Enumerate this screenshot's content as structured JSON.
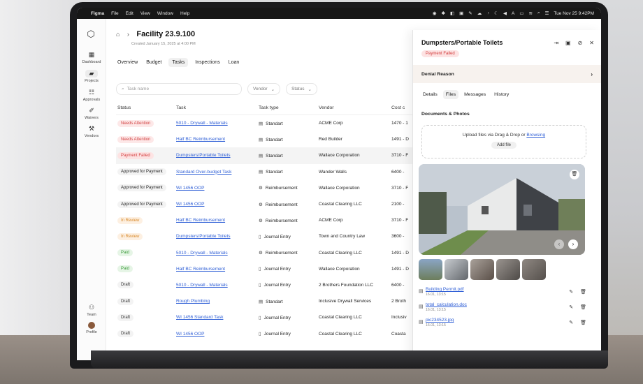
{
  "menubar": {
    "apple": "",
    "items": [
      "Figma",
      "File",
      "Edit",
      "View",
      "Window",
      "Help"
    ],
    "clock": "Tue Nov 25  9:42PM"
  },
  "rail": {
    "items": [
      {
        "label": "Dashboard",
        "icon": "grid-icon"
      },
      {
        "label": "Projects",
        "icon": "folder-icon"
      },
      {
        "label": "Approvals",
        "icon": "approvals-icon"
      },
      {
        "label": "Waivers",
        "icon": "waivers-icon"
      },
      {
        "label": "Vendors",
        "icon": "wrench-icon"
      },
      {
        "label": "Team",
        "icon": "team-icon"
      },
      {
        "label": "Profile",
        "icon": "avatar"
      }
    ]
  },
  "header": {
    "title": "Facility 23.9.100",
    "subtitle": "Created January 15, 2025 at 4:00 PM"
  },
  "tabs": [
    "Overview",
    "Budget",
    "Tasks",
    "Inspections",
    "Loan"
  ],
  "filters": {
    "search_placeholder": "Task name",
    "vendor": "Vendor",
    "status": "Status"
  },
  "table": {
    "columns": [
      "Status",
      "Task",
      "Task type",
      "Vendor",
      "Cost c"
    ],
    "rows": [
      {
        "status": "Needs Attention",
        "kind": "attn",
        "task": "5010 - Drywall - Materials",
        "type": "Standart",
        "vendor": "ACME Corp",
        "cost": "1470 - 1"
      },
      {
        "status": "Needs Attention",
        "kind": "attn",
        "task": "Half BC Reimbursement",
        "type": "Standart",
        "vendor": "Red Builder",
        "cost": "1491 - D"
      },
      {
        "status": "Payment Failed",
        "kind": "fail",
        "task": "Dumpsters/Portable Toilets",
        "type": "Standart",
        "vendor": "Wallace Corporation",
        "cost": "3710 - F"
      },
      {
        "status": "Approved for Payment",
        "kind": "appr",
        "task": "Standard Over-budget Task",
        "type": "Standart",
        "vendor": "Wander Walls",
        "cost": "6400 -"
      },
      {
        "status": "Approved for Payment",
        "kind": "appr",
        "task": "WI 1456 OOP",
        "type": "Reimbursement",
        "vendor": "Wallace Corporation",
        "cost": "3710 - F"
      },
      {
        "status": "Approved for Payment",
        "kind": "appr",
        "task": "WI 1456 OOP",
        "type": "Reimbursement",
        "vendor": "Coastal Clearing  LLC",
        "cost": "2100 -"
      },
      {
        "status": "In Review",
        "kind": "rev",
        "task": "Half BC Reimbursement",
        "type": "Reimbursement",
        "vendor": "ACME Corp",
        "cost": "3710 - F"
      },
      {
        "status": "In Review",
        "kind": "rev",
        "task": "Dumpsters/Portable Toilets",
        "type": "Journal Entry",
        "vendor": "Town and Country Law",
        "cost": "3600 -"
      },
      {
        "status": "Paid",
        "kind": "paid",
        "task": "5010 - Drywall - Materials",
        "type": "Reimbursement",
        "vendor": "Coastal Clearing  LLC",
        "cost": "1491 - D"
      },
      {
        "status": "Paid",
        "kind": "paid",
        "task": "Half BC Reimbursement",
        "type": "Journal Entry",
        "vendor": "Wallace Corporation",
        "cost": "1491 - D"
      },
      {
        "status": "Draft",
        "kind": "draft",
        "task": "5010 - Drywall - Materials",
        "type": "Journal Entry",
        "vendor": "2 Brothers Foundation LLC",
        "cost": "6400 -"
      },
      {
        "status": "Draft",
        "kind": "draft",
        "task": "Rough Plumbing",
        "type": "Standart",
        "vendor": "Inclusive Drywall Services",
        "cost": "2 Broth"
      },
      {
        "status": "Draft",
        "kind": "draft",
        "task": "WI 1456 Standard Task",
        "type": "Journal Entry",
        "vendor": "Coastal Clearing  LLC",
        "cost": "Inclusiv"
      },
      {
        "status": "Draft",
        "kind": "draft",
        "task": "WI 1456 OOP",
        "type": "Journal Entry",
        "vendor": "Coastal Clearing  LLC",
        "cost": "Coasta"
      }
    ]
  },
  "panel": {
    "title": "Dumpsters/Portable Toilets",
    "badge": "Payment Failed",
    "denial": "Denial Reason",
    "tabs": [
      "Details",
      "Files",
      "Messages",
      "History"
    ],
    "docs_heading": "Documents & Photos",
    "upload_text": "Upload files via Drag & Drop or",
    "upload_link": "Browsing",
    "add_file": "Add file",
    "files": [
      {
        "name": "Building Permit.pdf",
        "date": "16.01, 13:15"
      },
      {
        "name": "total_calculation.doc",
        "date": "16.01, 13:15"
      },
      {
        "name": "pic234523.jpg",
        "date": "16.01, 13:15"
      }
    ]
  },
  "colors": {
    "accent_link": "#2f5fd6",
    "fail_red": "#d23c3c",
    "review_orange": "#d98a2b",
    "paid_green": "#3a9a3a"
  }
}
